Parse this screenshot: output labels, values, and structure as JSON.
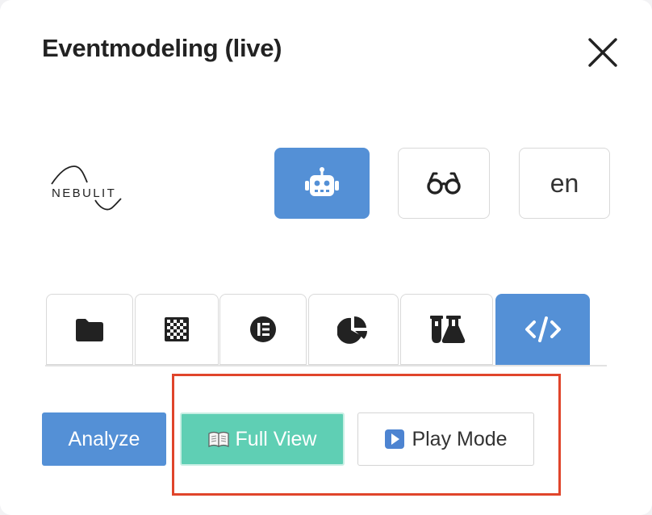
{
  "header": {
    "title": "Eventmodeling (live)",
    "close_icon": "close-icon"
  },
  "brand": {
    "logo_text": "NEBULIT"
  },
  "mode_buttons": {
    "assistant_icon": "robot-icon",
    "preview_icon": "glasses-icon",
    "language_label": "en"
  },
  "tabs": [
    {
      "icon": "folder-icon",
      "active": false
    },
    {
      "icon": "grid-icon",
      "active": false
    },
    {
      "icon": "list-circle-icon",
      "active": false
    },
    {
      "icon": "pie-chart-icon",
      "active": false
    },
    {
      "icon": "flask-icon",
      "active": false
    },
    {
      "icon": "code-icon",
      "active": true
    }
  ],
  "actions": {
    "analyze_label": "Analyze",
    "full_view_label": "Full View",
    "full_view_icon": "open-book-icon",
    "play_mode_label": "Play Mode",
    "play_mode_icon": "play-icon"
  },
  "colors": {
    "primary": "#5490d6",
    "full_view_green": "#5fcfb4",
    "highlight_red": "#e0452b"
  }
}
